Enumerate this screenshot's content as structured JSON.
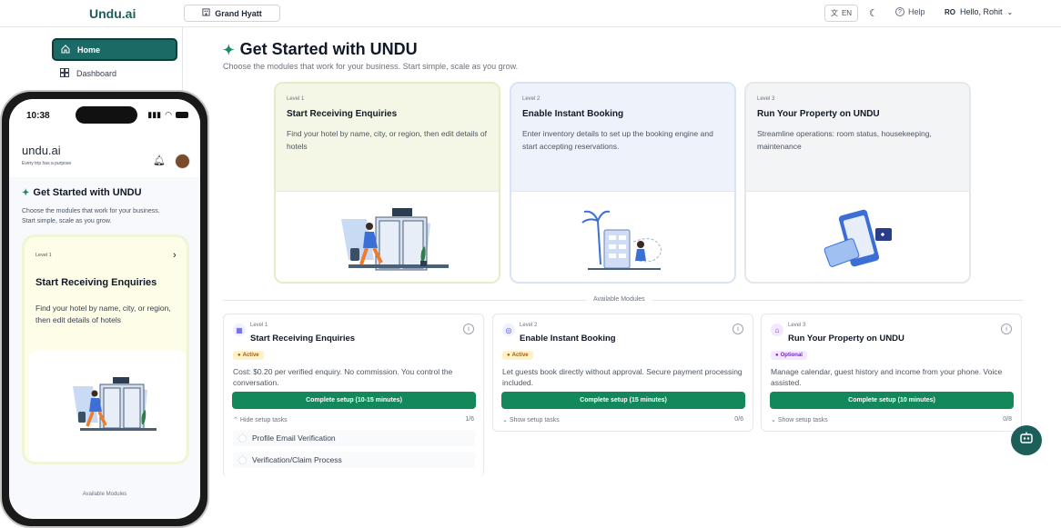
{
  "app": {
    "logo": "Undu.ai"
  },
  "header": {
    "hotel": "Grand Hyatt",
    "lang": "EN",
    "help": "Help",
    "user_initials": "RO",
    "user_greeting": "Hello, Rohit"
  },
  "sidebar": {
    "items": [
      {
        "label": "Home"
      },
      {
        "label": "Dashboard"
      }
    ]
  },
  "main": {
    "title": "Get Started with UNDU",
    "subtitle": "Choose the modules that work for your business. Start simple, scale as you grow.",
    "levels": [
      {
        "level": "Level 1",
        "title": "Start Receiving Enquiries",
        "desc": "Find your hotel by name, city, or region, then edit details of hotels",
        "bg": "#f5f7e6"
      },
      {
        "level": "Level 2",
        "title": "Enable Instant Booking",
        "desc": "Enter inventory details to set up the booking engine and start accepting reservations.",
        "bg": "#eef3fb"
      },
      {
        "level": "Level 3",
        "title": "Run Your Property on UNDU",
        "desc": "Streamline operations: room status, housekeeping, maintenance",
        "bg": "#f3f4f6"
      }
    ],
    "available_label": "Available Modules",
    "modules": [
      {
        "level": "Level 1",
        "title": "Start Receiving Enquiries",
        "badge": "Active",
        "desc": "Cost: $0.20 per verified enquiry. No commission. You control the conversation.",
        "button": "Complete setup (10-15 minutes)",
        "toggle": "Hide setup tasks",
        "count": "1/6",
        "tasks": [
          "Profile Email Verification",
          "Verification/Claim Process"
        ]
      },
      {
        "level": "Level 2",
        "title": "Enable Instant Booking",
        "badge": "Active",
        "desc": "Let guests book directly without approval. Secure payment processing included.",
        "button": "Complete setup (15 minutes)",
        "toggle": "Show setup tasks",
        "count": "0/6"
      },
      {
        "level": "Level 3",
        "title": "Run Your Property on UNDU",
        "badge": "Optional",
        "desc": "Manage calendar, guest history and income from your phone. Voice assisted.",
        "button": "Complete setup (10 minutes)",
        "toggle": "Show setup tasks",
        "count": "0/8"
      }
    ]
  },
  "phone": {
    "time": "10:38",
    "logo": "undu.ai",
    "tagline": "Every trip has a purpose",
    "title": "Get Started with UNDU",
    "subtitle": "Choose the modules that work for your business. Start simple, scale as you grow.",
    "card": {
      "level": "Level 1",
      "title": "Start Receiving Enquiries",
      "desc": "Find your hotel by name, city, or region, then edit details of hotels"
    },
    "available_label": "Available Modules"
  },
  "colors": {
    "brand": "#1b5e5a",
    "cta": "#13885a"
  }
}
